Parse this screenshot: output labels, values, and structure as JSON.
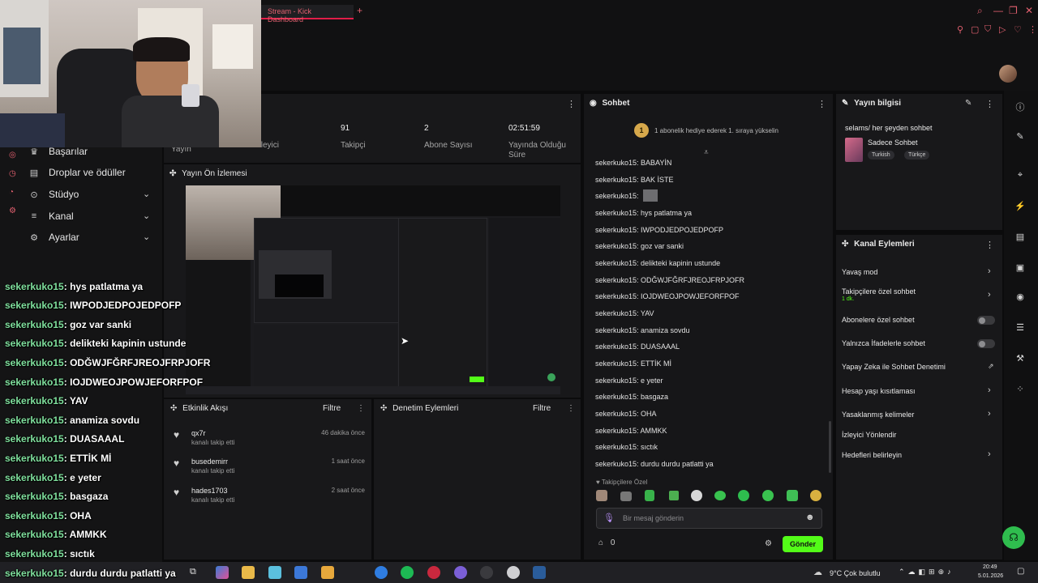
{
  "browser": {
    "tab_title": "Stream - Kick Dashboard",
    "new_tab": "+"
  },
  "sidebar": {
    "items": [
      {
        "label": "Başarılar",
        "icon": "trophy-icon"
      },
      {
        "label": "Droplar ve ödüller",
        "icon": "gift-icon"
      },
      {
        "label": "Stüdyo",
        "icon": "studio-icon"
      },
      {
        "label": "Kanal",
        "icon": "channel-icon"
      },
      {
        "label": "Ayarlar",
        "icon": "gear-icon"
      }
    ]
  },
  "stats": {
    "viewer_label_1": "Yayın",
    "viewer_label_2": "İzleyici",
    "followers_value": "91",
    "followers_label": "Takipçi",
    "subs_value": "2",
    "subs_label": "Abone Sayısı",
    "uptime_value": "02:51:59",
    "uptime_label": "Yayında Olduğu Süre"
  },
  "preview": {
    "title": "Yayın Ön İzlemesi"
  },
  "activity": {
    "title": "Etkinlik Akışı",
    "filter": "Filtre",
    "items": [
      {
        "user": "qx7r",
        "sub": "kanalı takip etti",
        "time": "46 dakika önce"
      },
      {
        "user": "busedemirr",
        "sub": "kanalı takip etti",
        "time": "1 saat önce"
      },
      {
        "user": "hades1703",
        "sub": "kanalı takip etti",
        "time": "2 saat önce"
      }
    ]
  },
  "moderation": {
    "title": "Denetim Eylemleri",
    "filter": "Filtre"
  },
  "chat": {
    "title": "Sohbet",
    "banner_badge": "1",
    "banner_text": "1 abonelik hediye ederek 1. sıraya yükselin",
    "messages": [
      "sekerkuko15: BABAYİN",
      "sekerkuko15: BAK İSTE",
      "sekerkuko15:",
      "sekerkuko15: hys patlatma ya",
      "sekerkuko15: IWPODJEDPOJEDPOFP",
      "sekerkuko15: goz var sanki",
      "sekerkuko15: delikteki kapinin ustunde",
      "sekerkuko15: ODĞWJFĞRFJREOJFRPJOFR",
      "sekerkuko15: IOJDWEOJPOWJEFORFPOF",
      "sekerkuko15: YAV",
      "sekerkuko15: anamiza sovdu",
      "sekerkuko15: DUASAAAL",
      "sekerkuko15: ETTİK Mİ",
      "sekerkuko15: e yeter",
      "sekerkuko15: basgaza",
      "sekerkuko15: OHA",
      "sekerkuko15: AMMKK",
      "sekerkuko15: sıctık",
      "sekerkuko15: durdu durdu patlatti ya"
    ],
    "followers_only": "Takipçilere Özel",
    "input_placeholder": "Bir mesaj gönderin",
    "points": "0",
    "send": "Gönder"
  },
  "overlay_chat": [
    {
      "user": "sekerkuko15",
      "text": ": hys patlatma ya"
    },
    {
      "user": "sekerkuko15",
      "text": ": IWPODJEDPOJEDPOFP"
    },
    {
      "user": "sekerkuko15",
      "text": ": goz var sanki"
    },
    {
      "user": "sekerkuko15",
      "text": ": delikteki kapinin ustunde"
    },
    {
      "user": "sekerkuko15",
      "text": ": ODĞWJFĞRFJREOJFRPJOFR"
    },
    {
      "user": "sekerkuko15",
      "text": ": IOJDWEOJPOWJEFORFPOF"
    },
    {
      "user": "sekerkuko15",
      "text": ": YAV"
    },
    {
      "user": "sekerkuko15",
      "text": ": anamiza sovdu"
    },
    {
      "user": "sekerkuko15",
      "text": ": DUASAAAL"
    },
    {
      "user": "sekerkuko15",
      "text": ": ETTİK Mİ"
    },
    {
      "user": "sekerkuko15",
      "text": ": e yeter"
    },
    {
      "user": "sekerkuko15",
      "text": ": basgaza"
    },
    {
      "user": "sekerkuko15",
      "text": ": OHA"
    },
    {
      "user": "sekerkuko15",
      "text": ": AMMKK"
    },
    {
      "user": "sekerkuko15",
      "text": ": sıctık"
    },
    {
      "user": "sekerkuko15",
      "text": ": durdu durdu patlatti ya"
    }
  ],
  "stream_info": {
    "title": "Yayın bilgisi",
    "stream_title": "selams/ her şeyden sohbet",
    "category": "Sadece Sohbet",
    "tags": [
      "Turkish",
      "Türkçe"
    ]
  },
  "channel_actions": {
    "title": "Kanal Eylemleri",
    "items": [
      {
        "label": "Yavaş mod",
        "control": "chevron"
      },
      {
        "label": "Takipçilere özel sohbet",
        "sub": "1 dk.",
        "control": "chevron"
      },
      {
        "label": "Abonelere özel sohbet",
        "control": "toggle"
      },
      {
        "label": "Yalnızca İfadelerle sohbet",
        "control": "toggle"
      },
      {
        "label": "Yapay Zeka ile Sohbet Denetimi",
        "control": "external"
      },
      {
        "label": "Hesap yaşı kısıtlaması",
        "control": "chevron"
      },
      {
        "label": "Yasaklanmış kelimeler",
        "control": "chevron"
      },
      {
        "label": "İzleyici Yönlendir",
        "control": "none"
      },
      {
        "label": "Hedefleri belirleyin",
        "control": "chevron"
      }
    ]
  },
  "taskbar": {
    "weather": "9°C Çok bulutlu",
    "time": "20:49",
    "date": "5.01.2026"
  },
  "colors": {
    "accent_green": "#53fc18",
    "accent_red": "#e11d48"
  }
}
